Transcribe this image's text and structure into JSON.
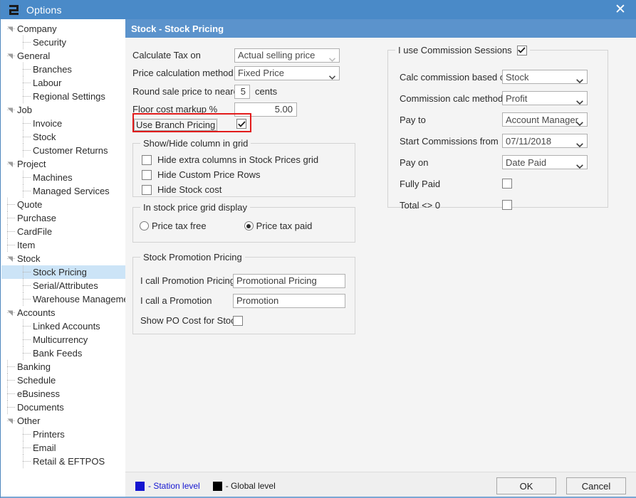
{
  "window": {
    "title": "Options",
    "icon": "options-app-icon",
    "close_label": "✕"
  },
  "sidebar": {
    "items": [
      {
        "label": "Company",
        "level": 0,
        "expander": true,
        "selected": false
      },
      {
        "label": "Security",
        "level": 1,
        "expander": false,
        "selected": false
      },
      {
        "label": "General",
        "level": 0,
        "expander": true,
        "selected": false
      },
      {
        "label": "Branches",
        "level": 1,
        "expander": false,
        "selected": false
      },
      {
        "label": "Labour",
        "level": 1,
        "expander": false,
        "selected": false
      },
      {
        "label": "Regional Settings",
        "level": 1,
        "expander": false,
        "selected": false
      },
      {
        "label": "Job",
        "level": 0,
        "expander": true,
        "selected": false
      },
      {
        "label": "Invoice",
        "level": 1,
        "expander": false,
        "selected": false
      },
      {
        "label": "Stock",
        "level": 1,
        "expander": false,
        "selected": false
      },
      {
        "label": "Customer Returns",
        "level": 1,
        "expander": false,
        "selected": false
      },
      {
        "label": "Project",
        "level": 0,
        "expander": true,
        "selected": false
      },
      {
        "label": "Machines",
        "level": 1,
        "expander": false,
        "selected": false
      },
      {
        "label": "Managed Services",
        "level": 1,
        "expander": false,
        "selected": false
      },
      {
        "label": "Quote",
        "level": 0,
        "expander": false,
        "selected": false
      },
      {
        "label": "Purchase",
        "level": 0,
        "expander": false,
        "selected": false
      },
      {
        "label": "CardFile",
        "level": 0,
        "expander": false,
        "selected": false
      },
      {
        "label": "Item",
        "level": 0,
        "expander": false,
        "selected": false
      },
      {
        "label": "Stock",
        "level": 0,
        "expander": true,
        "selected": false
      },
      {
        "label": "Stock Pricing",
        "level": 1,
        "expander": false,
        "selected": true
      },
      {
        "label": "Serial/Attributes",
        "level": 1,
        "expander": false,
        "selected": false
      },
      {
        "label": "Warehouse Management",
        "level": 1,
        "expander": false,
        "selected": false
      },
      {
        "label": "Accounts",
        "level": 0,
        "expander": true,
        "selected": false
      },
      {
        "label": "Linked Accounts",
        "level": 1,
        "expander": false,
        "selected": false
      },
      {
        "label": "Multicurrency",
        "level": 1,
        "expander": false,
        "selected": false
      },
      {
        "label": "Bank Feeds",
        "level": 1,
        "expander": false,
        "selected": false
      },
      {
        "label": "Banking",
        "level": 0,
        "expander": false,
        "selected": false
      },
      {
        "label": "Schedule",
        "level": 0,
        "expander": false,
        "selected": false
      },
      {
        "label": "eBusiness",
        "level": 0,
        "expander": false,
        "selected": false
      },
      {
        "label": "Documents",
        "level": 0,
        "expander": false,
        "selected": false
      },
      {
        "label": "Other",
        "level": 0,
        "expander": true,
        "selected": false
      },
      {
        "label": "Printers",
        "level": 1,
        "expander": false,
        "selected": false
      },
      {
        "label": "Email",
        "level": 1,
        "expander": false,
        "selected": false
      },
      {
        "label": "Retail & EFTPOS",
        "level": 1,
        "expander": false,
        "selected": false
      }
    ]
  },
  "page": {
    "header": "Stock - Stock Pricing"
  },
  "left": {
    "calculate_tax_on": {
      "label": "Calculate Tax on",
      "value": "Actual selling price"
    },
    "price_calculation_method": {
      "label": "Price calculation method",
      "value": "Fixed Price"
    },
    "round_sale_price": {
      "label": "Round sale price to nearest",
      "value": "5",
      "suffix": "cents"
    },
    "floor_cost_markup": {
      "label": "Floor cost markup %",
      "value": "5.00"
    },
    "use_branch_pricing": {
      "label": "Use Branch Pricing",
      "checked": true
    },
    "show_hide_group": {
      "title": "Show/Hide column in grid",
      "items": [
        {
          "label": "Hide extra columns in Stock Prices grid",
          "checked": false
        },
        {
          "label": "Hide Custom Price Rows",
          "checked": false
        },
        {
          "label": "Hide Stock cost",
          "checked": false
        }
      ]
    },
    "grid_display_group": {
      "title": "In stock price grid display",
      "options": [
        {
          "label": "Price tax free",
          "selected": false
        },
        {
          "label": "Price tax paid",
          "selected": true
        }
      ]
    },
    "promotion_group": {
      "title": "Stock Promotion Pricing",
      "promotion_pricing": {
        "label": "I call Promotion Pricing",
        "value": "Promotional Pricing"
      },
      "promotion": {
        "label": "I call a Promotion",
        "value": "Promotion"
      },
      "show_po_cost": {
        "label": "Show PO Cost for Stock",
        "checked": false
      }
    }
  },
  "right": {
    "group_title": "I use Commission Sessions",
    "group_checked": true,
    "fields": [
      {
        "label": "Calc commission based on",
        "value": "Stock",
        "type": "select"
      },
      {
        "label": "Commission calc method",
        "value": "Profit",
        "type": "select"
      },
      {
        "label": "Pay to",
        "value": "Account Manager",
        "type": "select"
      },
      {
        "label": "Start Commissions from",
        "value": "07/11/2018",
        "type": "select"
      },
      {
        "label": "Pay on",
        "value": "Date Paid",
        "type": "select"
      },
      {
        "label": "Fully Paid",
        "value": "",
        "type": "checkbox",
        "checked": false
      },
      {
        "label": "Total <> 0",
        "value": "",
        "type": "checkbox",
        "checked": false
      }
    ]
  },
  "footer": {
    "legend": [
      {
        "label": "- Station level",
        "color": "#1515d0"
      },
      {
        "label": "- Global level",
        "color": "#000000"
      }
    ],
    "ok_label": "OK",
    "cancel_label": "Cancel"
  },
  "colors": {
    "titlebar": "#4a8ac8",
    "page_header": "#5b93cc",
    "selection": "#cce4f7",
    "highlight": "#e21b1b",
    "station_level": "#1515d0",
    "global_level": "#000000"
  }
}
